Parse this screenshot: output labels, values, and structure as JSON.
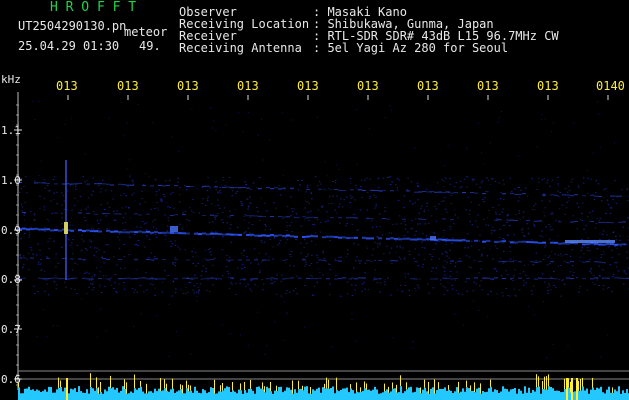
{
  "header": {
    "app_name": "H R O F F T",
    "filename": "UT2504290130.pn",
    "meteor_label": "meteor",
    "datetime": "25.04.29 01:30",
    "count": "49.",
    "info_labels": [
      "Observer",
      "Receiving Location",
      "Receiver",
      "Receiving Antenna"
    ],
    "info_values": [
      ": Masaki Kano",
      ": Shibukawa, Gunma, Japan",
      ": RTL-SDR SDR# 43dB L15 96.7MHz CW",
      ": 5el Yagi Az 280 for Seoul"
    ]
  },
  "axis": {
    "unit": "kHz",
    "y_ticks": [
      "1.1",
      "1.0",
      "0.9",
      "0.8",
      "0.7",
      "0.6"
    ],
    "x_ticks": [
      "013",
      "013",
      "013",
      "013",
      "013",
      "013",
      "013",
      "013",
      "013",
      "0140"
    ]
  },
  "colors": {
    "background": "#000000",
    "text_green": "#22d24a",
    "text_white": "#e8e8e8",
    "text_yellow": "#ffee33",
    "signal_blue": "#2a55ff",
    "noise_cyan": "#22c8ff"
  }
}
